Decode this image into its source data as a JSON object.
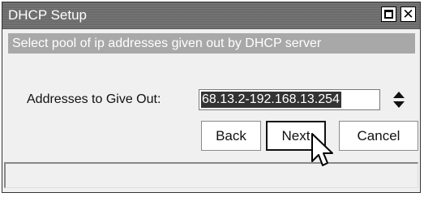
{
  "window": {
    "title": "DHCP Setup",
    "maximize_icon": "maximize-icon",
    "close_icon": "close-icon",
    "close_glyph": "✕"
  },
  "subtitle": "Select pool of ip addresses given out by DHCP server",
  "field": {
    "label": "Addresses to Give Out:",
    "value": "68.13.2-192.168.13.254",
    "spinner_icon": "up-down-arrows-icon"
  },
  "buttons": {
    "back": "Back",
    "next": "Next",
    "cancel": "Cancel"
  },
  "status": {
    "text": ""
  },
  "pointer": {
    "icon": "mouse-pointer-icon"
  }
}
